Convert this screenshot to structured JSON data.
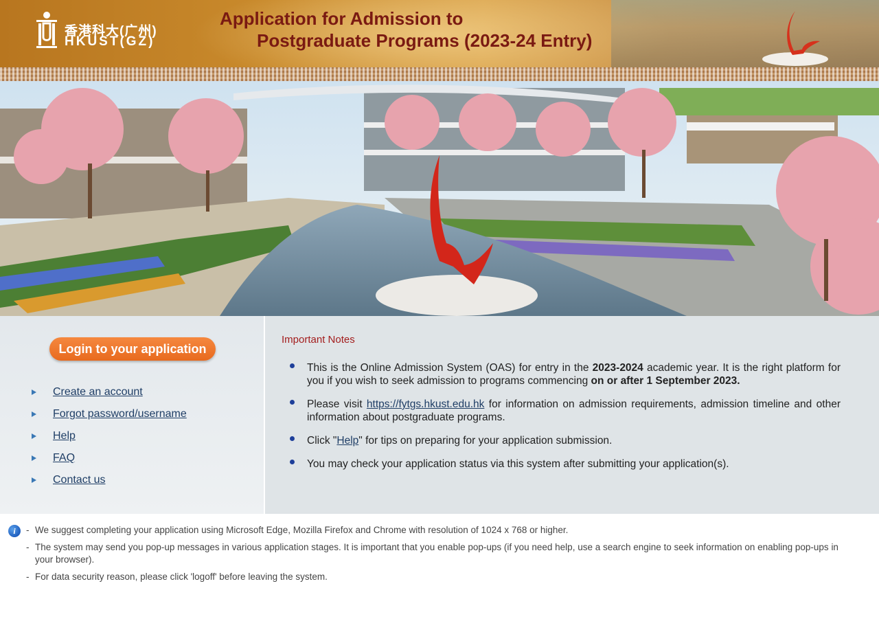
{
  "header": {
    "logo_cn": "香港科大(广州)",
    "logo_en": "HKUST(GZ)",
    "title_line1": "Application for Admission to",
    "title_line2": "Postgraduate Programs (2023-24 Entry)"
  },
  "sidebar": {
    "login_label": "Login to your application",
    "links": [
      {
        "label": "Create an account",
        "icon": "triangle-right-icon"
      },
      {
        "label": "Forgot password/username",
        "icon": "triangle-right-icon"
      },
      {
        "label": "Help",
        "icon": "triangle-right-icon"
      },
      {
        "label": "FAQ",
        "icon": "triangle-right-icon"
      },
      {
        "label": "Contact us",
        "icon": "triangle-right-icon"
      }
    ]
  },
  "notes": {
    "title": "Important Notes",
    "n1_a": "This is the Online Admission System (OAS) for entry in the ",
    "n1_b": "2023-2024",
    "n1_c": " academic year. It is the right platform for you if you wish to seek admission to programs commencing ",
    "n1_d": "on or after 1 September 2023.",
    "n2_a": "Please visit ",
    "n2_link": "https://fytgs.hkust.edu.hk",
    "n2_b": " for information on admission requirements, admission timeline and other information about postgraduate programs.",
    "n3_a": "Click \"",
    "n3_link": "Help",
    "n3_b": "\" for tips on preparing for your application submission.",
    "n4": "You may check your application status via this system after submitting your application(s)."
  },
  "footer": {
    "items": [
      "We suggest completing your application using Microsoft Edge, Mozilla Firefox and Chrome with resolution of 1024 x 768 or higher.",
      "The system may send you pop-up messages in various application stages. It is important that you enable pop-ups (if you need help, use a search engine to seek information on enabling pop-ups in your browser).",
      "For data security reason, please click 'logoff' before leaving the system."
    ],
    "dash": "-",
    "info_glyph": "i"
  },
  "colors": {
    "header_title": "#7a1a12",
    "login_button": "#e86a1e",
    "notes_title": "#a31d1d",
    "link": "#1f3e66",
    "bullet": "#1e3f9a"
  }
}
